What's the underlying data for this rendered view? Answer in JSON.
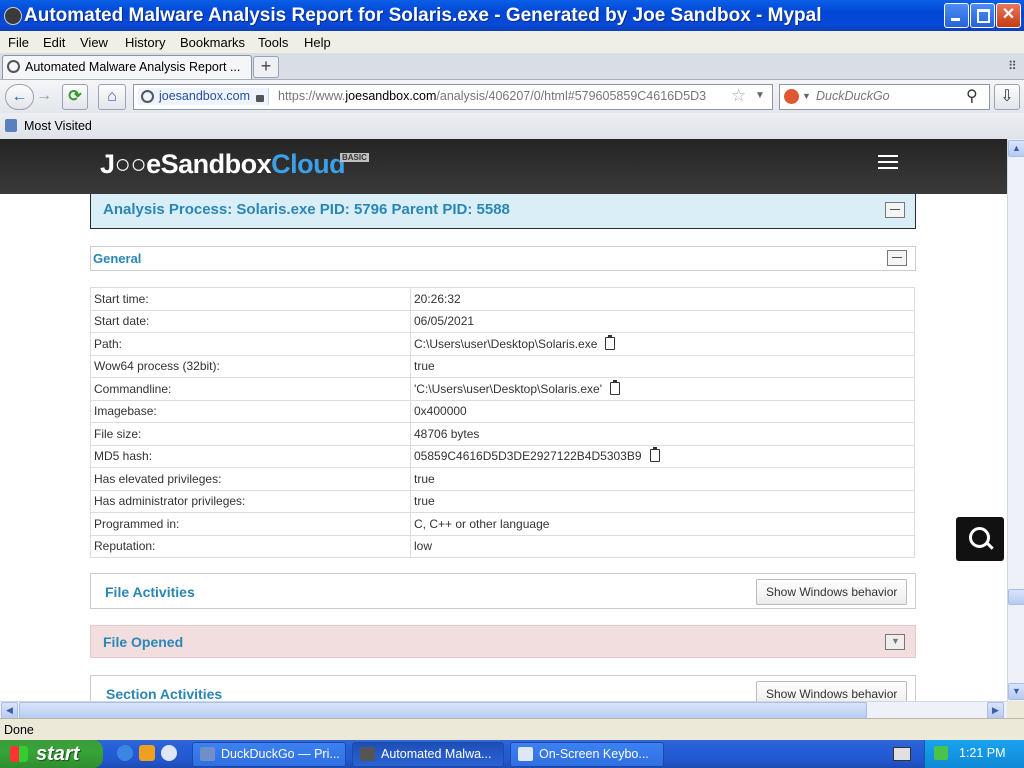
{
  "window": {
    "title": "Automated Malware Analysis Report for Solaris.exe - Generated by Joe Sandbox - Mypal"
  },
  "menu": [
    "File",
    "Edit",
    "View",
    "History",
    "Bookmarks",
    "Tools",
    "Help"
  ],
  "tabs": [
    {
      "label": "Automated Malware Analysis Report ..."
    }
  ],
  "newtab_label": "+",
  "urlbar": {
    "site": "joesandbox.com",
    "url_prefix": "https://www.",
    "url_host": "joesandbox.com",
    "url_path": "/analysis/406207/0/html#579605859C4616D5D3"
  },
  "search": {
    "placeholder": "DuckDuckGo"
  },
  "bookmarks": {
    "most_visited": "Most Visited"
  },
  "site": {
    "logo_joe": "J○○e",
    "logo_sandbox": "Sandbox",
    "logo_cloud": "Cloud",
    "logo_badge": "BASIC"
  },
  "process_header": "Analysis Process: Solaris.exe PID: 5796 Parent PID: 5588",
  "general": {
    "title": "General",
    "rows": [
      {
        "k": "Start time:",
        "v": "20:26:32"
      },
      {
        "k": "Start date:",
        "v": "06/05/2021"
      },
      {
        "k": "Path:",
        "v": "C:\\Users\\user\\Desktop\\Solaris.exe",
        "clip": true
      },
      {
        "k": "Wow64 process (32bit):",
        "v": "true"
      },
      {
        "k": "Commandline:",
        "v": "'C:\\Users\\user\\Desktop\\Solaris.exe'",
        "clip": true
      },
      {
        "k": "Imagebase:",
        "v": "0x400000"
      },
      {
        "k": "File size:",
        "v": "48706 bytes"
      },
      {
        "k": "MD5 hash:",
        "v": "05859C4616D5D3DE2927122B4D5303B9",
        "clip": true
      },
      {
        "k": "Has elevated privileges:",
        "v": "true"
      },
      {
        "k": "Has administrator privileges:",
        "v": "true"
      },
      {
        "k": "Programmed in:",
        "v": "C, C++ or other language"
      },
      {
        "k": "Reputation:",
        "v": "low"
      }
    ]
  },
  "file_activities": {
    "title": "File Activities",
    "button": "Show Windows behavior"
  },
  "file_opened": {
    "title": "File Opened"
  },
  "section_activities": {
    "title": "Section Activities",
    "button": "Show Windows behavior"
  },
  "status": "Done",
  "taskbar": {
    "start": "start",
    "tasks": [
      "DuckDuckGo — Pri...",
      "Automated Malwa...",
      "On-Screen Keybo..."
    ],
    "clock": "1:21 PM"
  },
  "colors": {
    "accent": "#2a86b5",
    "process_bg": "#d9eef7",
    "file_opened_bg": "#f2dede"
  }
}
